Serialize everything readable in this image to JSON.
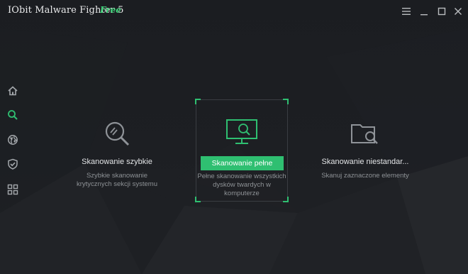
{
  "window": {
    "title": "IObit Malware Fighter 5",
    "edition": "Free",
    "controls": [
      "menu-icon",
      "minimize-icon",
      "maximize-icon",
      "close-icon"
    ]
  },
  "colors": {
    "accent": "#2fbf71",
    "edition_text": "#3fd57a",
    "background": "#1c1e22",
    "icon_muted": "#9ea2a6"
  },
  "sidebar": {
    "items": [
      {
        "icon": "home-icon",
        "active": false
      },
      {
        "icon": "search-icon",
        "active": true
      },
      {
        "icon": "globe-icon",
        "active": false
      },
      {
        "icon": "shield-check-icon",
        "active": false
      },
      {
        "icon": "grid-icon",
        "active": false
      }
    ]
  },
  "scans": {
    "quick": {
      "icon": "magnifier-icon",
      "title": "Skanowanie szybkie",
      "desc_line1": "Szybkie skanowanie",
      "desc_line2": "krytycznych sekcji systemu"
    },
    "full": {
      "icon": "monitor-search-icon",
      "button_label": "Skanowanie pełne",
      "desc_line1": "Pełne skanowanie wszystkich",
      "desc_line2": "dysków twardych w",
      "desc_line3": "komputerze"
    },
    "custom": {
      "icon": "folder-search-icon",
      "title": "Skanowanie niestandar...",
      "desc_line1": "Skanuj zaznaczone elementy"
    }
  }
}
